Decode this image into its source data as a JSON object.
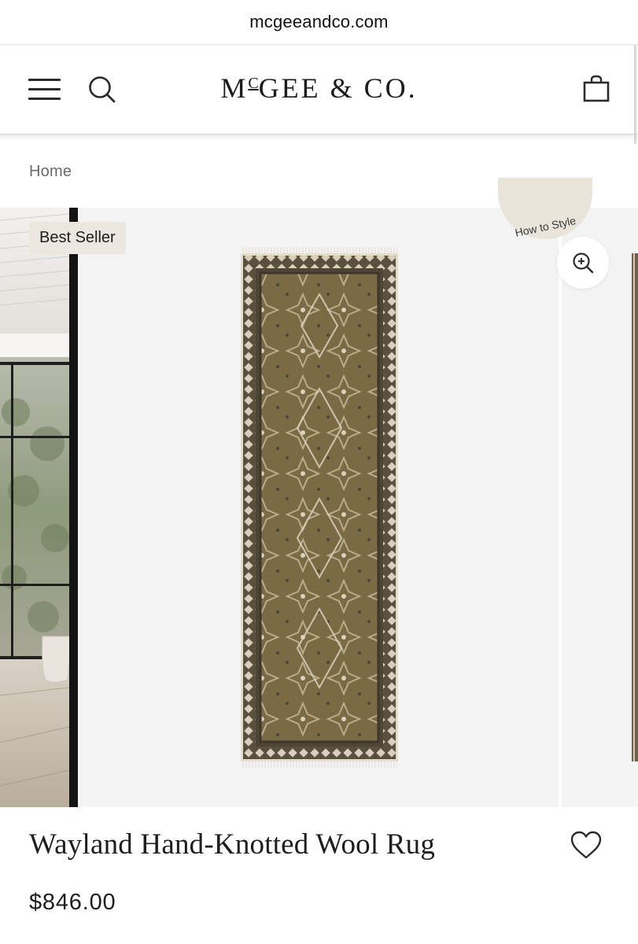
{
  "browser": {
    "url": "mcgeeandco.com"
  },
  "header": {
    "logo_main": "M",
    "logo_sup": "C",
    "logo_rest": "GEE & CO."
  },
  "breadcrumb": {
    "home": "Home"
  },
  "gallery": {
    "badge": "Best Seller",
    "how_to_style": "How to Style"
  },
  "product": {
    "title": "Wayland Hand-Knotted Wool Rug",
    "price": "$846.00"
  },
  "icons": [
    "hamburger-menu-icon",
    "search-icon",
    "shopping-bag-icon",
    "zoom-in-icon",
    "heart-icon"
  ],
  "colors": {
    "rug_field": "#7a6b45",
    "rug_border": "#5b4f3d",
    "badge_bg": "#ebe7df",
    "gallery_bg": "#f3f3f3"
  }
}
